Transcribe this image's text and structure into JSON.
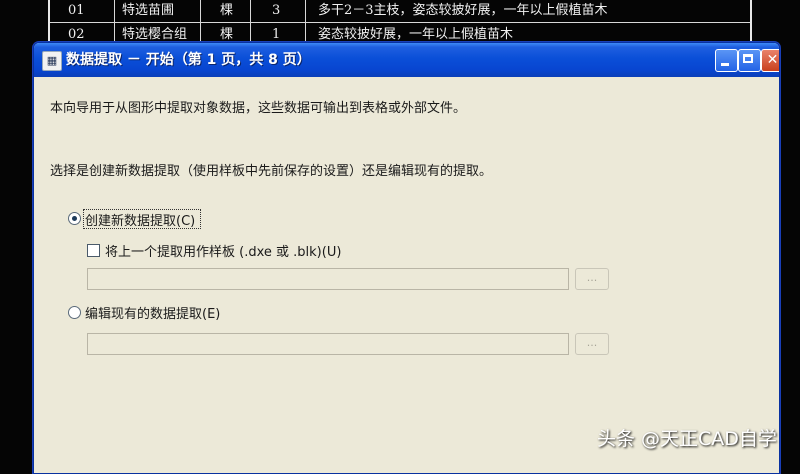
{
  "background_table": {
    "rows": [
      {
        "no": "01",
        "name": "特选苗圃",
        "unit": "棵",
        "qty": "3",
        "spec": "多干2－3主枝，姿态较披好展，一年以上假植苗木"
      },
      {
        "no": "02",
        "name": "特选樱合组",
        "unit": "棵",
        "qty": "1",
        "spec": "姿态较披好展，一年以上假植苗木"
      }
    ]
  },
  "window": {
    "title": "数据提取 － 开始（第 1 页，共 8 页）",
    "icon": "app-icon",
    "controls": {
      "minimize": "minimize-icon",
      "maximize": "maximize-icon",
      "close": "close-icon"
    }
  },
  "content": {
    "intro_text": "本向导用于从图形中提取对象数据，这些数据可输出到表格或外部文件。",
    "prompt_text": "选择是创建新数据提取（使用样板中先前保存的设置）还是编辑现有的提取。",
    "option_new": {
      "label": "创建新数据提取(C)",
      "checked": true
    },
    "template_checkbox": {
      "label": "将上一个提取用作样板 (.dxe 或 .blk)(U)",
      "checked": false
    },
    "template_path": {
      "value": ""
    },
    "template_browse": "...",
    "option_edit": {
      "label": "编辑现有的数据提取(E)",
      "checked": false
    },
    "edit_path": {
      "value": ""
    },
    "edit_browse": "..."
  },
  "watermark": "头条 @天正CAD自学",
  "colors": {
    "titlebar": "#0a4fd8",
    "dialog_bg": "#ece9d8",
    "close_button": "#c9401d"
  }
}
